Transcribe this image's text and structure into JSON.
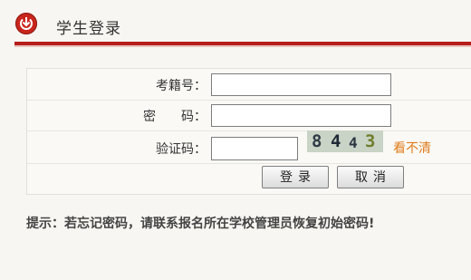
{
  "header": {
    "title": "学生登录",
    "icon": "down-arrow-circle-icon"
  },
  "form": {
    "exam_number_label": "考籍号：",
    "password_label": "密　　码：",
    "captcha_label": "验证码：",
    "exam_number_value": "",
    "password_value": "",
    "captcha_value": "",
    "captcha_digits": [
      "8",
      "4",
      "4",
      "3"
    ],
    "captcha_refresh": "看不清"
  },
  "buttons": {
    "login": "登录",
    "cancel": "取消"
  },
  "tip": "提示：若忘记密码，请联系报名所在学校管理员恢复初始密码!",
  "colors": {
    "accent": "#b51e1b",
    "link": "#e07b1b"
  }
}
